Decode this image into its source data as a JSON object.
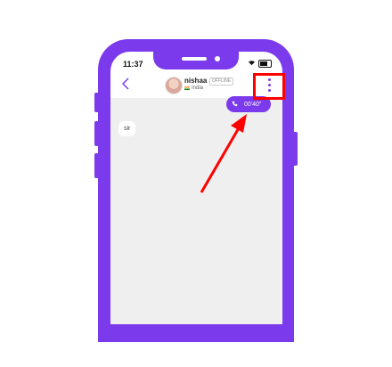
{
  "status_bar": {
    "time": "11:37"
  },
  "header": {
    "contact_name": "nishaa",
    "status_badge": "OFFLINE",
    "country": "India"
  },
  "call_pill": {
    "duration": "00'40\""
  },
  "messages": [
    {
      "text": "sir"
    }
  ],
  "colors": {
    "accent": "#7c3aed",
    "annotation": "#ff0000"
  },
  "icons": [
    "back-chevron-icon",
    "kebab-menu-icon",
    "phone-icon",
    "wifi-icon",
    "battery-icon"
  ]
}
